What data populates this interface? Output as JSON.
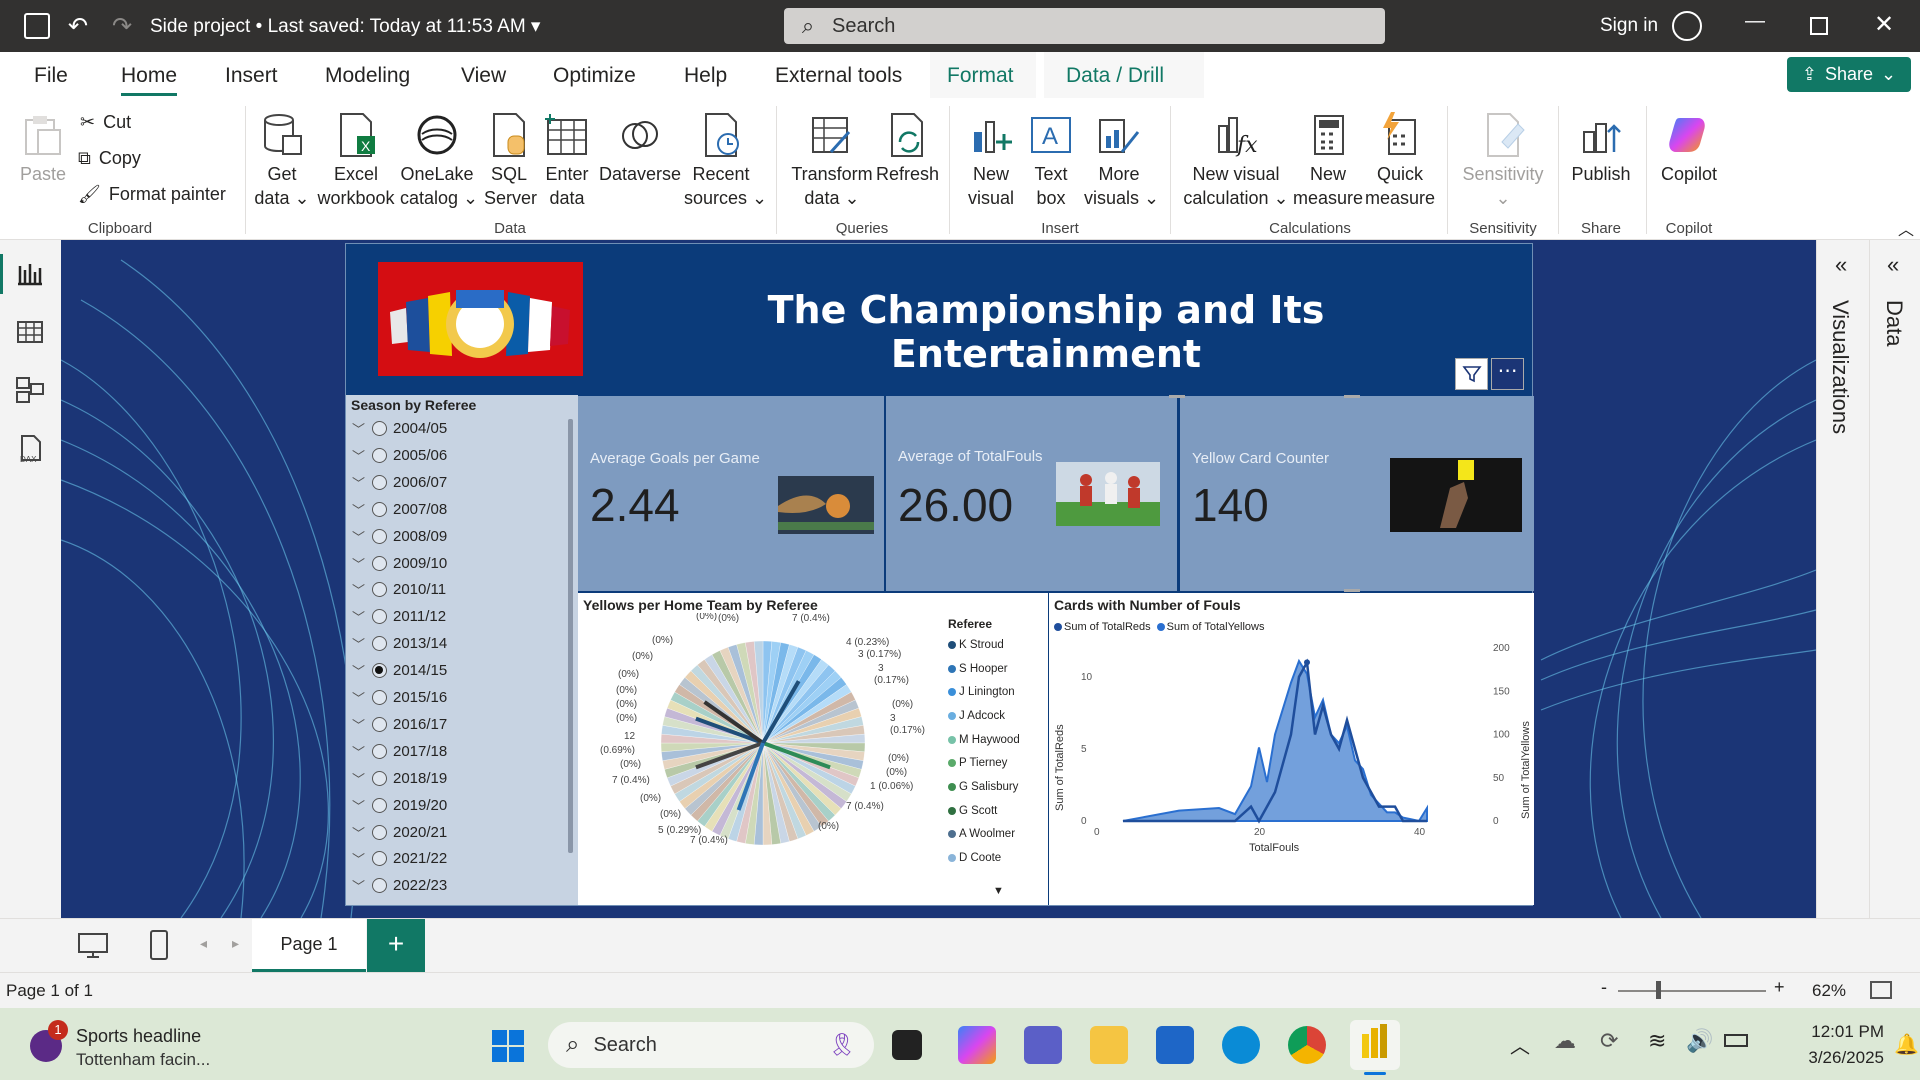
{
  "titlebar": {
    "doc_title": "Side project",
    "saved": "Last saved: Today at 11:53 AM",
    "search_placeholder": "Search",
    "sign_in": "Sign in"
  },
  "menu": {
    "tabs": [
      "File",
      "Home",
      "Insert",
      "Modeling",
      "View",
      "Optimize",
      "Help",
      "External tools",
      "Format",
      "Data / Drill"
    ],
    "share": "Share"
  },
  "ribbon": {
    "clipboard": {
      "paste": "Paste",
      "cut": "Cut",
      "copy": "Copy",
      "format_painter": "Format painter",
      "group": "Clipboard"
    },
    "data": {
      "get_data_1": "Get",
      "get_data_2": "data",
      "excel_1": "Excel",
      "excel_2": "workbook",
      "onelake_1": "OneLake",
      "onelake_2": "catalog",
      "sql_1": "SQL",
      "sql_2": "Server",
      "enter_1": "Enter",
      "enter_2": "data",
      "dataverse": "Dataverse",
      "recent_1": "Recent",
      "recent_2": "sources",
      "group": "Data"
    },
    "queries": {
      "transform_1": "Transform",
      "transform_2": "data",
      "refresh": "Refresh",
      "group": "Queries"
    },
    "insert": {
      "newvisual_1": "New",
      "newvisual_2": "visual",
      "textbox_1": "Text",
      "textbox_2": "box",
      "more_1": "More",
      "more_2": "visuals",
      "group": "Insert"
    },
    "calculations": {
      "newcalc_1": "New visual",
      "newcalc_2": "calculation",
      "newmeasure_1": "New",
      "newmeasure_2": "measure",
      "quick_1": "Quick",
      "quick_2": "measure",
      "group": "Calculations"
    },
    "sensitivity": {
      "label": "Sensitivity",
      "group": "Sensitivity"
    },
    "share": {
      "publish": "Publish",
      "group": "Share"
    },
    "copilot": {
      "label": "Copilot",
      "group": "Copilot"
    }
  },
  "panes": {
    "visualizations": "Visualizations",
    "data": "Data"
  },
  "report": {
    "title": "The Championship and Its Entertainment",
    "slicer": {
      "title": "Season by Referee",
      "selected": "2014/15",
      "items": [
        "2004/05",
        "2005/06",
        "2006/07",
        "2007/08",
        "2008/09",
        "2009/10",
        "2010/11",
        "2011/12",
        "2013/14",
        "2014/15",
        "2015/16",
        "2016/17",
        "2017/18",
        "2018/19",
        "2019/20",
        "2020/21",
        "2021/22",
        "2022/23"
      ]
    },
    "cards": [
      {
        "label": "Average Goals per Game",
        "value": "2.44"
      },
      {
        "label": "Average of TotalFouls",
        "value": "26.00"
      },
      {
        "label": "Yellow Card Counter",
        "value": "140"
      }
    ],
    "pie": {
      "title": "Yellows per Home Team by Referee",
      "legend_title": "Referee",
      "legend": [
        "K Stroud",
        "S Hooper",
        "J Linington",
        "J Adcock",
        "M Haywood",
        "P Tierney",
        "G Salisbury",
        "G Scott",
        "A Woolmer",
        "D Coote"
      ],
      "legend_colors": [
        "#1f4e79",
        "#2e75b6",
        "#3a8fd9",
        "#6aaee0",
        "#77c2a8",
        "#5aaa6a",
        "#3e8e50",
        "#2f7040",
        "#4e6f8f",
        "#8ab4d9"
      ],
      "labels_right": [
        "7 (0.4%)",
        "4 (0.23%)",
        "3 (0.17%)",
        "3",
        "(0.17%)",
        "(0%)",
        "3",
        "(0.17%)",
        "(0%)",
        "(0%)",
        "1 (0.06%)",
        "7 (0.4%)",
        "(0%)"
      ],
      "labels_left": [
        "(0%)",
        "(0%)",
        "(0%)",
        "(0%)",
        "(0%)",
        "(0%)",
        "(0%)",
        "(0%)",
        "12",
        "(0.69%)",
        "(0%)",
        "7 (0.4%)",
        "(0%)",
        "(0%)",
        "5 (0.29%)",
        "7 (0.4%)"
      ]
    },
    "area": {
      "title": "Cards with Number of Fouls",
      "legend": [
        "Sum of TotalReds",
        "Sum of TotalYellows"
      ],
      "colors": [
        "#1f4e9c",
        "#2a6fd0"
      ],
      "xlabel": "TotalFouls",
      "ylabel_left": "Sum of TotalReds",
      "ylabel_right": "Sum of TotalYellows"
    }
  },
  "pagetabs": {
    "page1": "Page 1"
  },
  "status": {
    "page": "Page 1 of 1",
    "zoom": "62%"
  },
  "taskbar": {
    "news_title": "Sports headline",
    "news_sub": "Tottenham facin...",
    "badge": "1",
    "search": "Search",
    "time": "12:01 PM",
    "date": "3/26/2025"
  },
  "chart_data": [
    {
      "type": "area",
      "title": "Cards with Number of Fouls",
      "xlabel": "TotalFouls",
      "ylabel": "Sum of TotalReds",
      "y2label": "Sum of TotalYellows",
      "xlim": [
        0,
        45
      ],
      "ylim": [
        0,
        12
      ],
      "y2lim": [
        0,
        200
      ],
      "x": [
        3,
        10,
        15,
        17,
        19,
        20,
        21,
        22,
        23,
        24,
        25,
        26,
        27,
        28,
        29,
        30,
        31,
        32,
        33,
        34,
        35,
        36,
        37,
        38,
        39,
        40,
        41
      ],
      "series": [
        {
          "name": "Sum of TotalReds",
          "values": [
            0,
            0,
            0,
            0,
            1,
            0,
            1,
            2,
            4,
            6,
            10,
            11,
            6,
            8,
            6,
            5,
            7,
            5,
            3,
            2,
            1,
            1,
            1,
            0,
            0,
            0,
            0
          ]
        },
        {
          "name": "Sum of TotalYellows",
          "values": [
            0,
            12,
            15,
            8,
            40,
            85,
            45,
            100,
            130,
            160,
            185,
            170,
            120,
            140,
            100,
            90,
            110,
            70,
            60,
            30,
            20,
            10,
            10,
            4,
            2,
            0,
            15
          ]
        }
      ],
      "legend": "top-left"
    },
    {
      "type": "pie",
      "title": "Yellows per Home Team by Referee",
      "categories": [
        "K Stroud",
        "S Hooper",
        "J Linington",
        "J Adcock",
        "M Haywood",
        "P Tierney",
        "G Salisbury",
        "G Scott",
        "A Woolmer",
        "D Coote"
      ],
      "values": [
        7,
        4,
        3,
        3,
        3,
        1,
        7,
        12,
        7,
        5
      ]
    }
  ]
}
